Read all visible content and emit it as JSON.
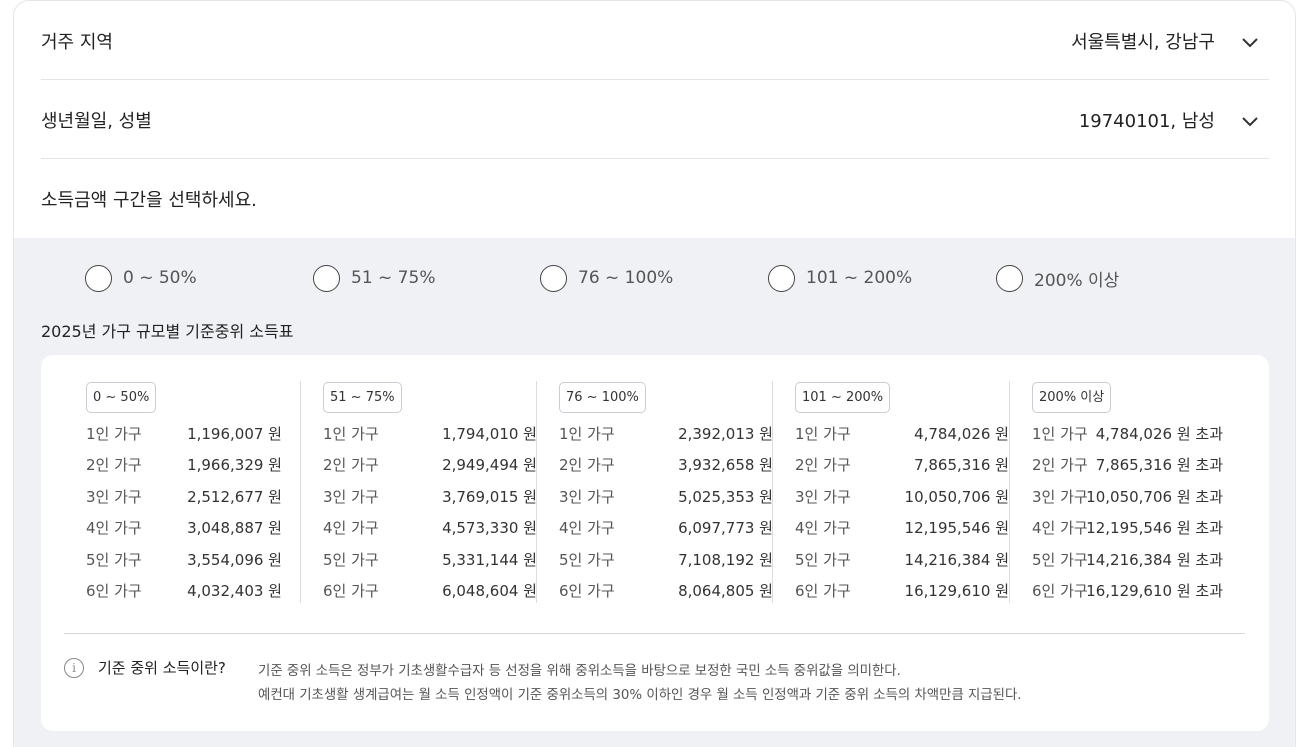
{
  "region": {
    "label": "거주 지역",
    "value": "서울특별시, 강남구"
  },
  "birth": {
    "label": "생년월일, 성별",
    "value": "19740101, 남성"
  },
  "prompt": "소득금액 구간을 선택하세요.",
  "income_options": [
    "0 ~ 50%",
    "51 ~ 75%",
    "76 ~ 100%",
    "101 ~ 200%",
    "200% 이상"
  ],
  "table": {
    "title": "2025년 가구 규모별 기준중위 소득표",
    "columns": [
      {
        "badge": "0 ~ 50%",
        "rows": [
          {
            "household": "1인 가구",
            "amount": "1,196,007 원"
          },
          {
            "household": "2인 가구",
            "amount": "1,966,329 원"
          },
          {
            "household": "3인 가구",
            "amount": "2,512,677 원"
          },
          {
            "household": "4인 가구",
            "amount": "3,048,887 원"
          },
          {
            "household": "5인 가구",
            "amount": "3,554,096 원"
          },
          {
            "household": "6인 가구",
            "amount": "4,032,403 원"
          }
        ]
      },
      {
        "badge": "51 ~ 75%",
        "rows": [
          {
            "household": "1인 가구",
            "amount": "1,794,010 원"
          },
          {
            "household": "2인 가구",
            "amount": "2,949,494 원"
          },
          {
            "household": "3인 가구",
            "amount": "3,769,015 원"
          },
          {
            "household": "4인 가구",
            "amount": "4,573,330 원"
          },
          {
            "household": "5인 가구",
            "amount": "5,331,144 원"
          },
          {
            "household": "6인 가구",
            "amount": "6,048,604 원"
          }
        ]
      },
      {
        "badge": "76 ~ 100%",
        "rows": [
          {
            "household": "1인 가구",
            "amount": "2,392,013 원"
          },
          {
            "household": "2인 가구",
            "amount": "3,932,658 원"
          },
          {
            "household": "3인 가구",
            "amount": "5,025,353 원"
          },
          {
            "household": "4인 가구",
            "amount": "6,097,773 원"
          },
          {
            "household": "5인 가구",
            "amount": "7,108,192 원"
          },
          {
            "household": "6인 가구",
            "amount": "8,064,805 원"
          }
        ]
      },
      {
        "badge": "101 ~ 200%",
        "rows": [
          {
            "household": "1인 가구",
            "amount": "4,784,026 원"
          },
          {
            "household": "2인 가구",
            "amount": "7,865,316 원"
          },
          {
            "household": "3인 가구",
            "amount": "10,050,706 원"
          },
          {
            "household": "4인 가구",
            "amount": "12,195,546 원"
          },
          {
            "household": "5인 가구",
            "amount": "14,216,384 원"
          },
          {
            "household": "6인 가구",
            "amount": "16,129,610 원"
          }
        ]
      },
      {
        "badge": "200% 이상",
        "rows": [
          {
            "household": "1인 가구",
            "amount": "4,784,026 원 초과"
          },
          {
            "household": "2인 가구",
            "amount": "7,865,316 원 초과"
          },
          {
            "household": "3인 가구",
            "amount": "10,050,706 원 초과"
          },
          {
            "household": "4인 가구",
            "amount": "12,195,546 원 초과"
          },
          {
            "household": "5인 가구",
            "amount": "14,216,384 원 초과"
          },
          {
            "household": "6인 가구",
            "amount": "16,129,610 원 초과"
          }
        ]
      }
    ]
  },
  "info": {
    "icon": "info-icon",
    "title": "기준 중위 소득이란?",
    "line1": "기준 중위 소득은 정부가 기초생활수급자 등 선정을 위해 중위소득을 바탕으로 보정한 국민 소득 중위값을 의미한다.",
    "line2": "예컨대 기초생활 생계급여는 월 소득 인정액이 기준 중위소득의 30% 이하인 경우 월 소득 인정액과 기준 중위 소득의 차액만큼 지급된다."
  }
}
